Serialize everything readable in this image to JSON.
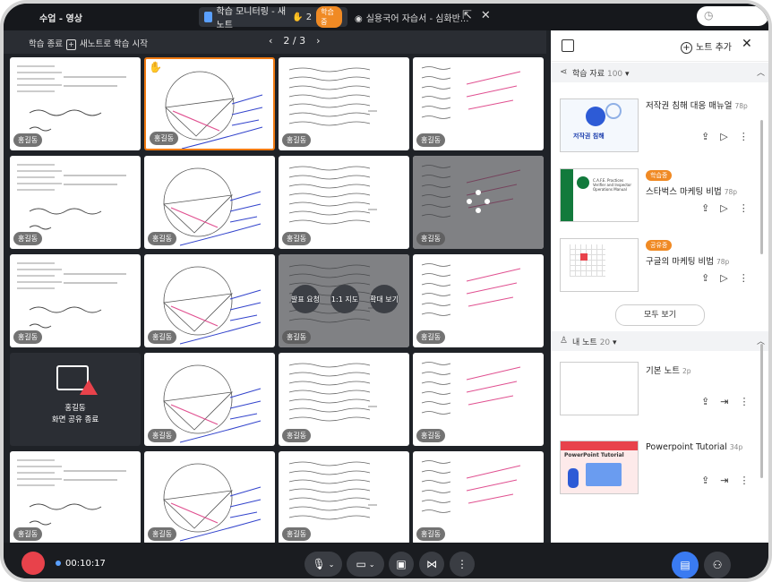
{
  "topbar": {
    "app_name": "수업 - 영상",
    "tab_active": "학습 모니터링 - 새노트",
    "hand_count": "2",
    "status_badge": "학습중",
    "tab_second": "실용국어 자습서 - 심화반...",
    "icons": [
      "eye-icon",
      "external-link-icon",
      "close-icon",
      "clock-icon"
    ]
  },
  "toolbar": {
    "end_label": "학습 종료",
    "new_note_label": "새노트로 학습 시작",
    "page_indicator": "2 / 3"
  },
  "grid": {
    "student_name": "홍길동",
    "actions": [
      "발표 요청",
      "1:1 지도",
      "확대 보기"
    ],
    "share_end_line1": "홍길동",
    "share_end_line2": "화면 공유 종료"
  },
  "panel": {
    "add_note_label": "노트 추가",
    "materials_section": {
      "label": "학습 자료",
      "count": "100"
    },
    "materials": [
      {
        "title": "저작권 침해 대응 매뉴얼",
        "pages": "78p",
        "badge": ""
      },
      {
        "title": "스타벅스 마케팅 비법",
        "pages": "78p",
        "badge": "학습중"
      },
      {
        "title": "구글의 마케팅 비법",
        "pages": "78p",
        "badge": "공유중"
      }
    ],
    "thumb_texts": {
      "copyright": "저작권 침해",
      "starbucks_small": "C.A.F.E. Practices Verifier and Inspector Operations Manual",
      "ppt_title": "PowerPoint Tutorial"
    },
    "see_all_label": "모두 보기",
    "notes_section": {
      "label": "내 노트",
      "count": "20"
    },
    "notes": [
      {
        "title": "기본 노트",
        "pages": "2p"
      },
      {
        "title": "Powerpoint Tutorial",
        "pages": "34p"
      }
    ]
  },
  "bottombar": {
    "timer": "00:10:17"
  }
}
